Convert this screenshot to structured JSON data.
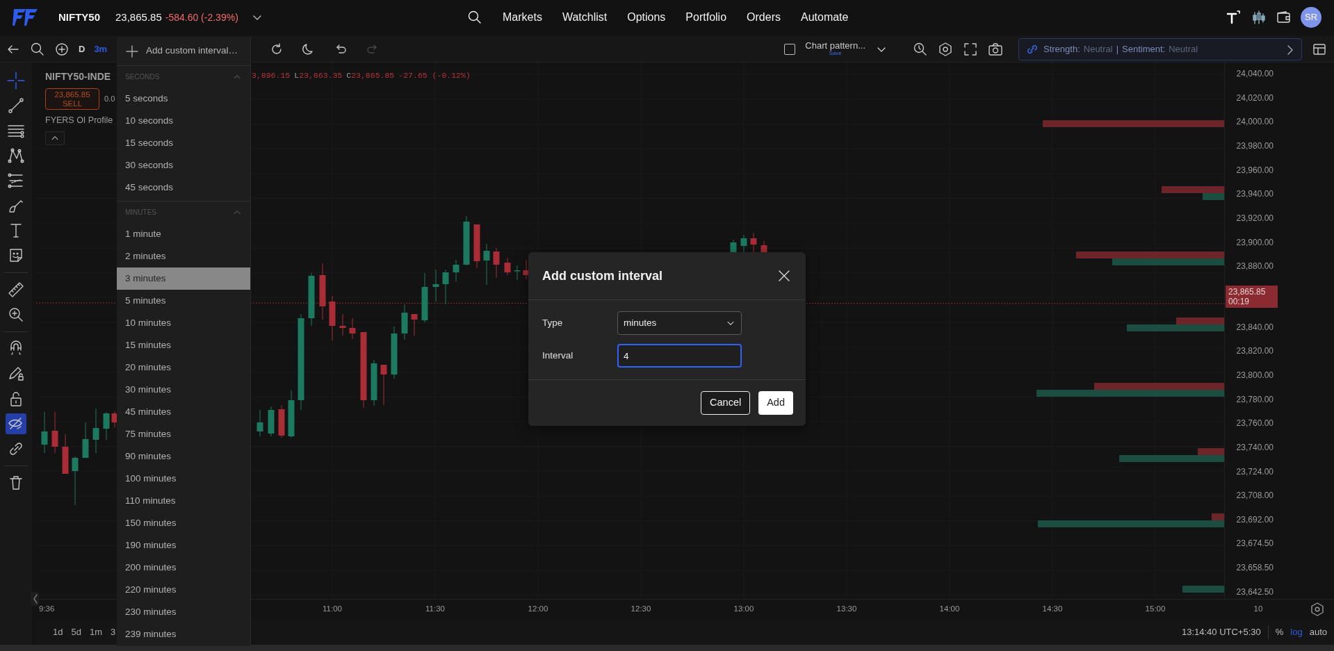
{
  "top_bar": {
    "symbol": "NIFTY50",
    "price": "23,865.85",
    "change": "-584.60 (-2.39%)",
    "nav": [
      {
        "label": "Markets"
      },
      {
        "label": "Watchlist"
      },
      {
        "label": "Options"
      },
      {
        "label": "Portfolio"
      },
      {
        "label": "Orders"
      },
      {
        "label": "Automate"
      }
    ],
    "avatar": "SR"
  },
  "chart_toolbar": {
    "period": "D",
    "interval": "3m",
    "pattern_checked": false,
    "chart_pattern": "Chart pattern...",
    "chart_pattern_note": "Save",
    "redo_disabled": true,
    "strength_label": "Strength:",
    "strength": "Neutral",
    "separator": "|",
    "sentiment_label": "Sentiment:",
    "sentiment": "Neutral"
  },
  "drawing_tools": [
    {
      "selected": true
    },
    {
      "selected": false
    },
    {
      "selected": false
    },
    {
      "selected": false
    },
    {
      "selected": false
    },
    {
      "selected": false
    },
    {
      "selected": false
    },
    {
      "selected": false
    },
    {
      "selected": false
    },
    {
      "selected": false
    }
  ],
  "toggles": [
    {
      "on": false
    },
    {
      "on": false
    },
    {
      "on": false
    },
    {
      "on": true
    },
    {
      "on": false
    }
  ],
  "legend": {
    "symbol": "NIFTY50-INDE",
    "sell_price": "23,865.85",
    "sell_label": "SELL",
    "spread": "0.0",
    "indicator": "FYERS OI Profile",
    "ohlc": [
      {
        "value": "3,896.15"
      },
      {
        "letter": "L",
        "value": "23,863.35"
      },
      {
        "letter": "C",
        "value": "23,865.85"
      }
    ],
    "change": "-27.65 (-0.12%)"
  },
  "interval_menu": {
    "add_label": "Add custom interval…",
    "groups": [
      {
        "title": "SECONDS",
        "expanded": true,
        "items": [
          {
            "label": "5 seconds",
            "selected": false
          },
          {
            "label": "10 seconds",
            "selected": false
          },
          {
            "label": "15 seconds",
            "selected": false
          },
          {
            "label": "30 seconds",
            "selected": false
          },
          {
            "label": "45 seconds",
            "selected": false
          }
        ]
      },
      {
        "title": "MINUTES",
        "expanded": true,
        "items": [
          {
            "label": "1 minute",
            "selected": false
          },
          {
            "label": "2 minutes",
            "selected": false
          },
          {
            "label": "3 minutes",
            "selected": true
          },
          {
            "label": "5 minutes",
            "selected": false
          },
          {
            "label": "10 minutes",
            "selected": false
          },
          {
            "label": "15 minutes",
            "selected": false
          },
          {
            "label": "20 minutes",
            "selected": false
          },
          {
            "label": "30 minutes",
            "selected": false
          },
          {
            "label": "45 minutes",
            "selected": false
          },
          {
            "label": "75 minutes",
            "selected": false
          },
          {
            "label": "90 minutes",
            "selected": false
          },
          {
            "label": "100 minutes",
            "selected": false
          },
          {
            "label": "110 minutes",
            "selected": false
          },
          {
            "label": "150 minutes",
            "selected": false
          },
          {
            "label": "190 minutes",
            "selected": false
          },
          {
            "label": "200 minutes",
            "selected": false
          },
          {
            "label": "220 minutes",
            "selected": false
          },
          {
            "label": "230 minutes",
            "selected": false
          },
          {
            "label": "239 minutes",
            "selected": false
          }
        ]
      }
    ]
  },
  "price_axis": {
    "ticks": [
      {
        "kind": "tick",
        "label": "24,040.00"
      },
      {
        "kind": "tick",
        "label": "24,020.00"
      },
      {
        "kind": "tick",
        "label": "24,000.00"
      },
      {
        "kind": "tick",
        "label": "23,980.00"
      },
      {
        "kind": "tick",
        "label": "23,960.00"
      },
      {
        "kind": "tick",
        "label": "23,940.00"
      },
      {
        "kind": "tick",
        "label": "23,920.00"
      },
      {
        "kind": "tick",
        "label": "23,900.00"
      },
      {
        "kind": "tick",
        "label": "23,880.00"
      },
      {
        "kind": "current",
        "label": "23,865.85",
        "countdown": "00:19"
      },
      {
        "kind": "tick",
        "label": "23,840.00"
      },
      {
        "kind": "tick",
        "label": "23,820.00"
      },
      {
        "kind": "tick",
        "label": "23,800.00"
      },
      {
        "kind": "tick",
        "label": "23,780.00"
      },
      {
        "kind": "tick",
        "label": "23,760.00"
      },
      {
        "kind": "tick",
        "label": "23,740.00"
      },
      {
        "kind": "tick",
        "label": "23,724.00"
      },
      {
        "kind": "tick",
        "label": "23,708.00"
      },
      {
        "kind": "tick",
        "label": "23,692.00"
      },
      {
        "kind": "tick",
        "label": "23,674.50"
      },
      {
        "kind": "tick",
        "label": "23,658.50"
      },
      {
        "kind": "tick",
        "label": "23,642.50"
      }
    ]
  },
  "time_axis": {
    "labels": [
      "9:36",
      "11:00",
      "11:30",
      "12:00",
      "12:30",
      "13:00",
      "13:30",
      "14:00",
      "14:30",
      "15:00",
      "10"
    ]
  },
  "range_buttons": [
    {
      "label": "1d"
    },
    {
      "label": "5d"
    },
    {
      "label": "1m"
    },
    {
      "label": "3"
    }
  ],
  "status_bar": {
    "time": "13:14:40 UTC+5:30",
    "percent": "%",
    "log": "log",
    "log_on": true,
    "auto": "auto"
  },
  "dialog": {
    "title": "Add custom interval",
    "fields": [
      {
        "kind": "select",
        "label": "Type",
        "value": "minutes"
      },
      {
        "kind": "input",
        "label": "Interval",
        "value": "4",
        "focused": true
      }
    ],
    "buttons": [
      {
        "kind": "secondary",
        "label": "Cancel"
      },
      {
        "kind": "primary",
        "label": "Add"
      }
    ]
  }
}
